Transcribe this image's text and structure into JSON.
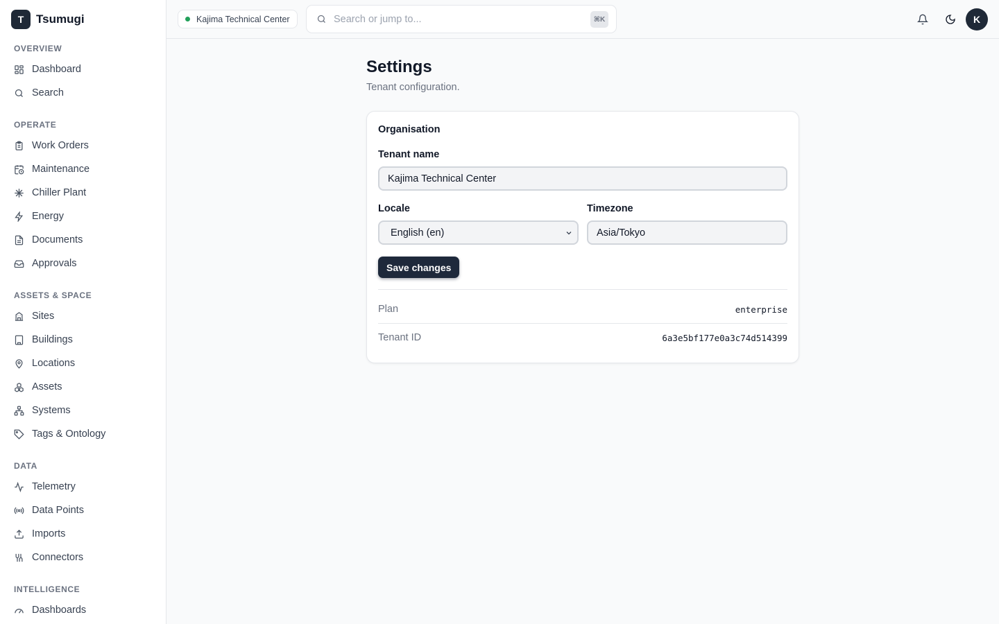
{
  "app": {
    "logo_letter": "T",
    "name": "Tsumugi"
  },
  "sidebar": {
    "sections": [
      {
        "label": "OVERVIEW"
      },
      {
        "label": "OPERATE"
      },
      {
        "label": "ASSETS & SPACE"
      },
      {
        "label": "DATA"
      },
      {
        "label": "INTELLIGENCE"
      }
    ],
    "items": [
      {
        "label": "Dashboard",
        "icon": "dashboard-icon"
      },
      {
        "label": "Search",
        "icon": "search-icon"
      },
      {
        "label": "Work Orders",
        "icon": "clipboard-icon"
      },
      {
        "label": "Maintenance",
        "icon": "calendar-clock-icon"
      },
      {
        "label": "Chiller Plant",
        "icon": "snowflake-icon"
      },
      {
        "label": "Energy",
        "icon": "lightning-icon"
      },
      {
        "label": "Documents",
        "icon": "document-icon"
      },
      {
        "label": "Approvals",
        "icon": "inbox-icon"
      },
      {
        "label": "Sites",
        "icon": "sites-icon"
      },
      {
        "label": "Buildings",
        "icon": "building-icon"
      },
      {
        "label": "Locations",
        "icon": "map-pin-icon"
      },
      {
        "label": "Assets",
        "icon": "boxes-icon"
      },
      {
        "label": "Systems",
        "icon": "network-icon"
      },
      {
        "label": "Tags & Ontology",
        "icon": "tag-icon"
      },
      {
        "label": "Telemetry",
        "icon": "activity-icon"
      },
      {
        "label": "Data Points",
        "icon": "radio-icon"
      },
      {
        "label": "Imports",
        "icon": "upload-icon"
      },
      {
        "label": "Connectors",
        "icon": "connector-icon"
      },
      {
        "label": "Dashboards",
        "icon": "gauge-icon"
      }
    ]
  },
  "topbar": {
    "tenant": "Kajima Technical Center",
    "tenant_status_color": "#22a05a",
    "search_placeholder": "Search or jump to...",
    "search_shortcut": "⌘K",
    "avatar_letter": "K"
  },
  "main": {
    "title": "Settings",
    "subtitle": "Tenant configuration.",
    "card": {
      "title": "Organisation",
      "tenant_name_label": "Tenant name",
      "tenant_name_value": "Kajima Technical Center",
      "locale_label": "Locale",
      "locale_value": "English (en)",
      "timezone_label": "Timezone",
      "timezone_value": "Asia/Tokyo",
      "save_label": "Save changes",
      "plan_label": "Plan",
      "plan_value": "enterprise",
      "tenant_id_label": "Tenant ID",
      "tenant_id_value": "6a3e5bf177e0a3c74d514399"
    }
  },
  "colors": {
    "accent": "#1e293b",
    "background": "#f9fafb"
  }
}
